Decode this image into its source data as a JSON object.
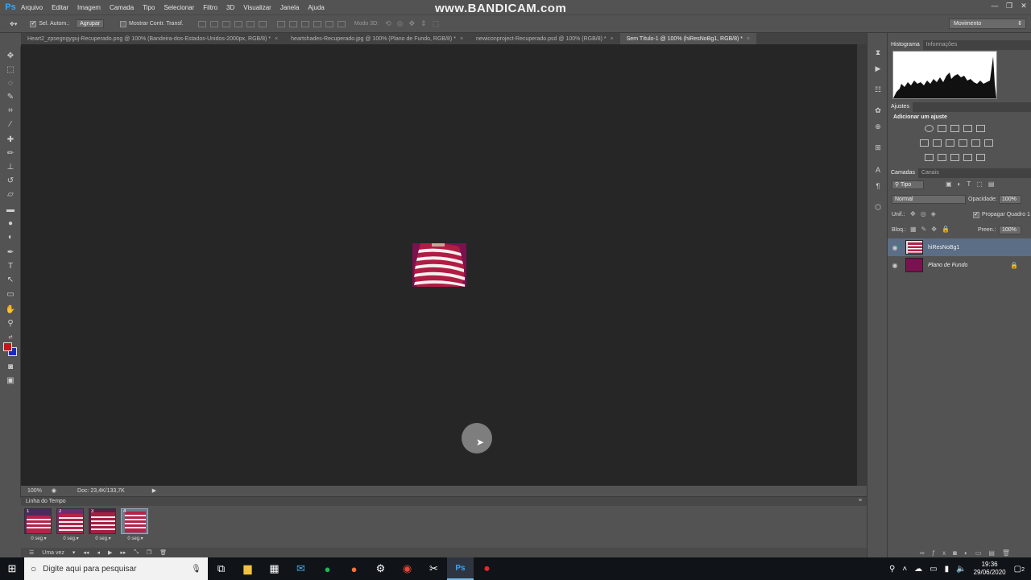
{
  "app": {
    "logo": "Ps",
    "watermark": "www.BANDICAM.com"
  },
  "menu": [
    "Arquivo",
    "Editar",
    "Imagem",
    "Camada",
    "Tipo",
    "Selecionar",
    "Filtro",
    "3D",
    "Visualizar",
    "Janela",
    "Ajuda"
  ],
  "window_controls": [
    "—",
    "❐",
    "✕"
  ],
  "options": {
    "auto_select_label": "Sel. Autom.:",
    "auto_select_value": "Agrupar",
    "show_transform_label": "Mostrar Contr. Transf.",
    "mode3d_label": "Modo 3D:",
    "workspace": "Movimento"
  },
  "tabs": [
    {
      "label": "Heart2_zpsegngyguj-Recuperado.png @ 100% (Bandeira-dos-Estados-Unidos-2000px, RGB/8) *",
      "active": false
    },
    {
      "label": "heartshades-Recuperado.jpg @ 100% (Plano de Fundo, RGB/8) *",
      "active": false
    },
    {
      "label": "newiconproject-Recuperado.psd @ 100% (RGB/8) *",
      "active": false
    },
    {
      "label": "Sem Título-1 @ 100% (hiResNoBg1, RGB/8) *",
      "active": true
    }
  ],
  "status": {
    "zoom": "100%",
    "doc": "Doc: 23,4K/133,7K"
  },
  "timeline": {
    "title": "Linha do Tempo",
    "frames": [
      {
        "num": "1",
        "delay": "0 seg.▾",
        "selected": false
      },
      {
        "num": "2",
        "delay": "0 seg.▾",
        "selected": false
      },
      {
        "num": "3",
        "delay": "0 seg.▾",
        "selected": false
      },
      {
        "num": "4",
        "delay": "0 seg.▾",
        "selected": true
      }
    ],
    "loop": "Uma vez"
  },
  "panels": {
    "histogram_tabs": [
      "Histograma",
      "Informações"
    ],
    "adjustments_tab": "Ajustes",
    "adjustments_title": "Adicionar um ajuste",
    "layers_tabs": [
      "Camadas",
      "Canais"
    ],
    "filter_kind": "Tipo",
    "blend_mode": "Normal",
    "opacity_label": "Opacidade:",
    "opacity_value": "100%",
    "unify_label": "Unif.:",
    "propagate_label": "Propagar Quadro 1",
    "lock_label": "Bloq.:",
    "fill_label": "Preen.:",
    "fill_value": "100%",
    "layers": [
      {
        "name": "hiResNoBg1",
        "selected": true,
        "italic": false
      },
      {
        "name": "Plano de Fundo",
        "selected": false,
        "italic": true
      }
    ]
  },
  "taskbar": {
    "search_placeholder": "Digite aqui para pesquisar",
    "time": "19:36",
    "date": "29/06/2020",
    "notifications": "2"
  }
}
